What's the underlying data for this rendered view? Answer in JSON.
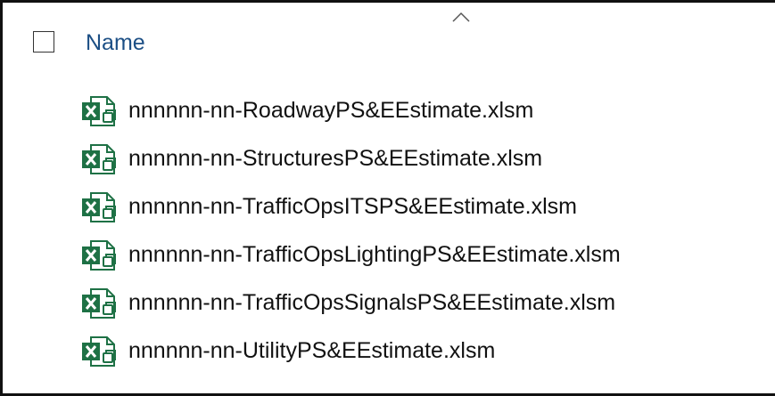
{
  "header": {
    "name_column": "Name"
  },
  "icons": {
    "file_icon": "excel-macro-workbook-icon",
    "sort_icon": "chevron-up-icon"
  },
  "colors": {
    "excel_green": "#1e7145",
    "header_text": "#1c4f85"
  },
  "files": [
    {
      "name": "nnnnnn-nn-RoadwayPS&EEstimate.xlsm"
    },
    {
      "name": "nnnnnn-nn-StructuresPS&EEstimate.xlsm"
    },
    {
      "name": "nnnnnn-nn-TrafficOpsITSPS&EEstimate.xlsm"
    },
    {
      "name": "nnnnnn-nn-TrafficOpsLightingPS&EEstimate.xlsm"
    },
    {
      "name": "nnnnnn-nn-TrafficOpsSignalsPS&EEstimate.xlsm"
    },
    {
      "name": "nnnnnn-nn-UtilityPS&EEstimate.xlsm"
    }
  ]
}
